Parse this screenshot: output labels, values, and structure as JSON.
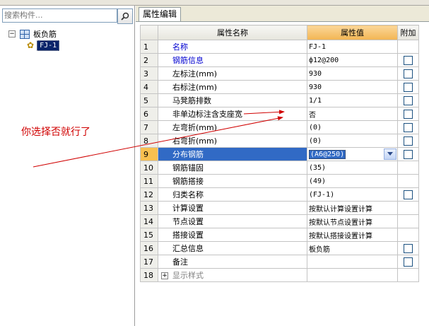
{
  "search": {
    "placeholder": "搜索构件..."
  },
  "tree": {
    "root_label": "板负筋",
    "child_label": "FJ-1"
  },
  "tab": {
    "label": "属性编辑"
  },
  "table": {
    "headers": {
      "name": "属性名称",
      "value": "属性值",
      "add": "附加"
    },
    "rows": [
      {
        "num": "1",
        "name": "名称",
        "value": "FJ-1",
        "blue": true,
        "check": false
      },
      {
        "num": "2",
        "name": "钢筋信息",
        "value": "ф12@200",
        "blue": true,
        "check": true
      },
      {
        "num": "3",
        "name": "左标注(mm)",
        "value": "930",
        "blue": false,
        "check": true
      },
      {
        "num": "4",
        "name": "右标注(mm)",
        "value": "930",
        "blue": false,
        "check": true
      },
      {
        "num": "5",
        "name": "马凳筋排数",
        "value": "1/1",
        "blue": false,
        "check": true
      },
      {
        "num": "6",
        "name": "非单边标注含支座宽",
        "value": "否",
        "blue": false,
        "check": true
      },
      {
        "num": "7",
        "name": "左弯折(mm)",
        "value": "(0)",
        "blue": false,
        "check": true
      },
      {
        "num": "8",
        "name": "右弯折(mm)",
        "value": "(0)",
        "blue": false,
        "check": true
      },
      {
        "num": "9",
        "name": "分布钢筋",
        "value": "(A6@250)",
        "blue": false,
        "check": true,
        "selected": true
      },
      {
        "num": "10",
        "name": "钢筋锚固",
        "value": "(35)",
        "blue": false,
        "check": false
      },
      {
        "num": "11",
        "name": "钢筋搭接",
        "value": "(49)",
        "blue": false,
        "check": false
      },
      {
        "num": "12",
        "name": "归类名称",
        "value": "(FJ-1)",
        "blue": false,
        "check": true
      },
      {
        "num": "13",
        "name": "计算设置",
        "value": "按默认计算设置计算",
        "blue": false,
        "check": false
      },
      {
        "num": "14",
        "name": "节点设置",
        "value": "按默认节点设置计算",
        "blue": false,
        "check": false
      },
      {
        "num": "15",
        "name": "搭接设置",
        "value": "按默认搭接设置计算",
        "blue": false,
        "check": false
      },
      {
        "num": "16",
        "name": "汇总信息",
        "value": "板负筋",
        "blue": false,
        "check": true
      },
      {
        "num": "17",
        "name": "备注",
        "value": "",
        "blue": false,
        "check": true
      },
      {
        "num": "18",
        "name": "显示样式",
        "value": "",
        "blue": false,
        "check": false,
        "expandable": true
      }
    ]
  },
  "annotation": {
    "text": "你选择否就行了",
    "color": "#d00000"
  },
  "colors": {
    "selection": "#316ac5",
    "header_value": "#f2b552",
    "link_blue": "#0000d0"
  }
}
